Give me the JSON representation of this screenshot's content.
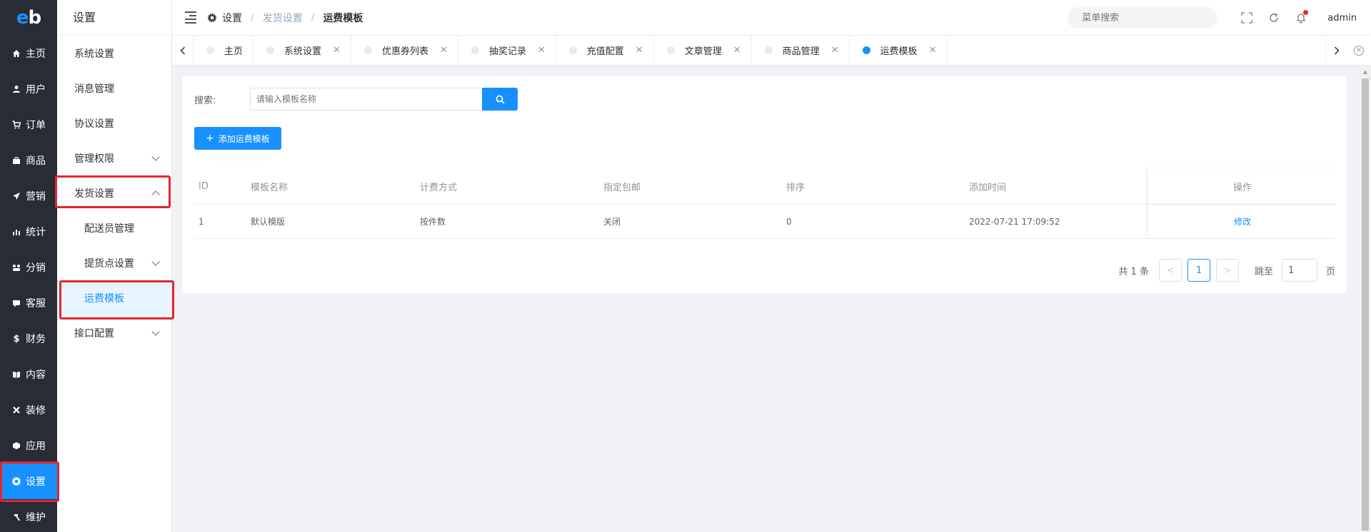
{
  "logo": {
    "text_e": "e",
    "text_b": "b"
  },
  "nav1": [
    {
      "label": "主页",
      "icon": "home-icon"
    },
    {
      "label": "用户",
      "icon": "user-icon"
    },
    {
      "label": "订单",
      "icon": "cart-icon"
    },
    {
      "label": "商品",
      "icon": "shop-icon"
    },
    {
      "label": "营销",
      "icon": "send-icon"
    },
    {
      "label": "统计",
      "icon": "bar-chart-icon"
    },
    {
      "label": "分销",
      "icon": "distribution-icon"
    },
    {
      "label": "客服",
      "icon": "chat-icon"
    },
    {
      "label": "财务",
      "icon": "dollar-icon"
    },
    {
      "label": "内容",
      "icon": "book-icon"
    },
    {
      "label": "装修",
      "icon": "tools-icon"
    },
    {
      "label": "应用",
      "icon": "cube-icon"
    },
    {
      "label": "设置",
      "icon": "gear-icon"
    },
    {
      "label": "维护",
      "icon": "hammer-icon"
    }
  ],
  "nav2": {
    "title": "设置",
    "items": [
      {
        "label": "系统设置"
      },
      {
        "label": "消息管理"
      },
      {
        "label": "协议设置"
      },
      {
        "label": "管理权限"
      },
      {
        "label": "发货设置"
      },
      {
        "label": "配送员管理"
      },
      {
        "label": "提货点设置"
      },
      {
        "label": "运费模板"
      },
      {
        "label": "接口配置"
      }
    ]
  },
  "header": {
    "breadcrumb": [
      "设置",
      "发货设置",
      "运费模板"
    ],
    "search_placeholder": "菜单搜索",
    "user": "admin"
  },
  "tabs": [
    {
      "label": "主页"
    },
    {
      "label": "系统设置"
    },
    {
      "label": "优惠券列表"
    },
    {
      "label": "抽奖记录"
    },
    {
      "label": "充值配置"
    },
    {
      "label": "文章管理"
    },
    {
      "label": "商品管理"
    },
    {
      "label": "运费模板"
    }
  ],
  "search": {
    "label": "搜索:",
    "placeholder": "请输入模板名称"
  },
  "add_button": "添加运费模板",
  "table": {
    "headers": [
      "ID",
      "模板名称",
      "计费方式",
      "指定包邮",
      "排序",
      "添加时间",
      "操作"
    ],
    "rows": [
      {
        "id": "1",
        "name": "默认模版",
        "billing": "按件数",
        "free_shipping": "关闭",
        "sort": "0",
        "time": "2022-07-21 17:09:52",
        "action": "修改"
      }
    ]
  },
  "pager": {
    "total": "共 1 条",
    "current": "1",
    "jump_label": "跳至",
    "jump_value": "1",
    "page_suffix": "页"
  },
  "colors": {
    "primary": "#1890ff",
    "nav_dark": "#282c34",
    "highlight": "#e5262d"
  }
}
